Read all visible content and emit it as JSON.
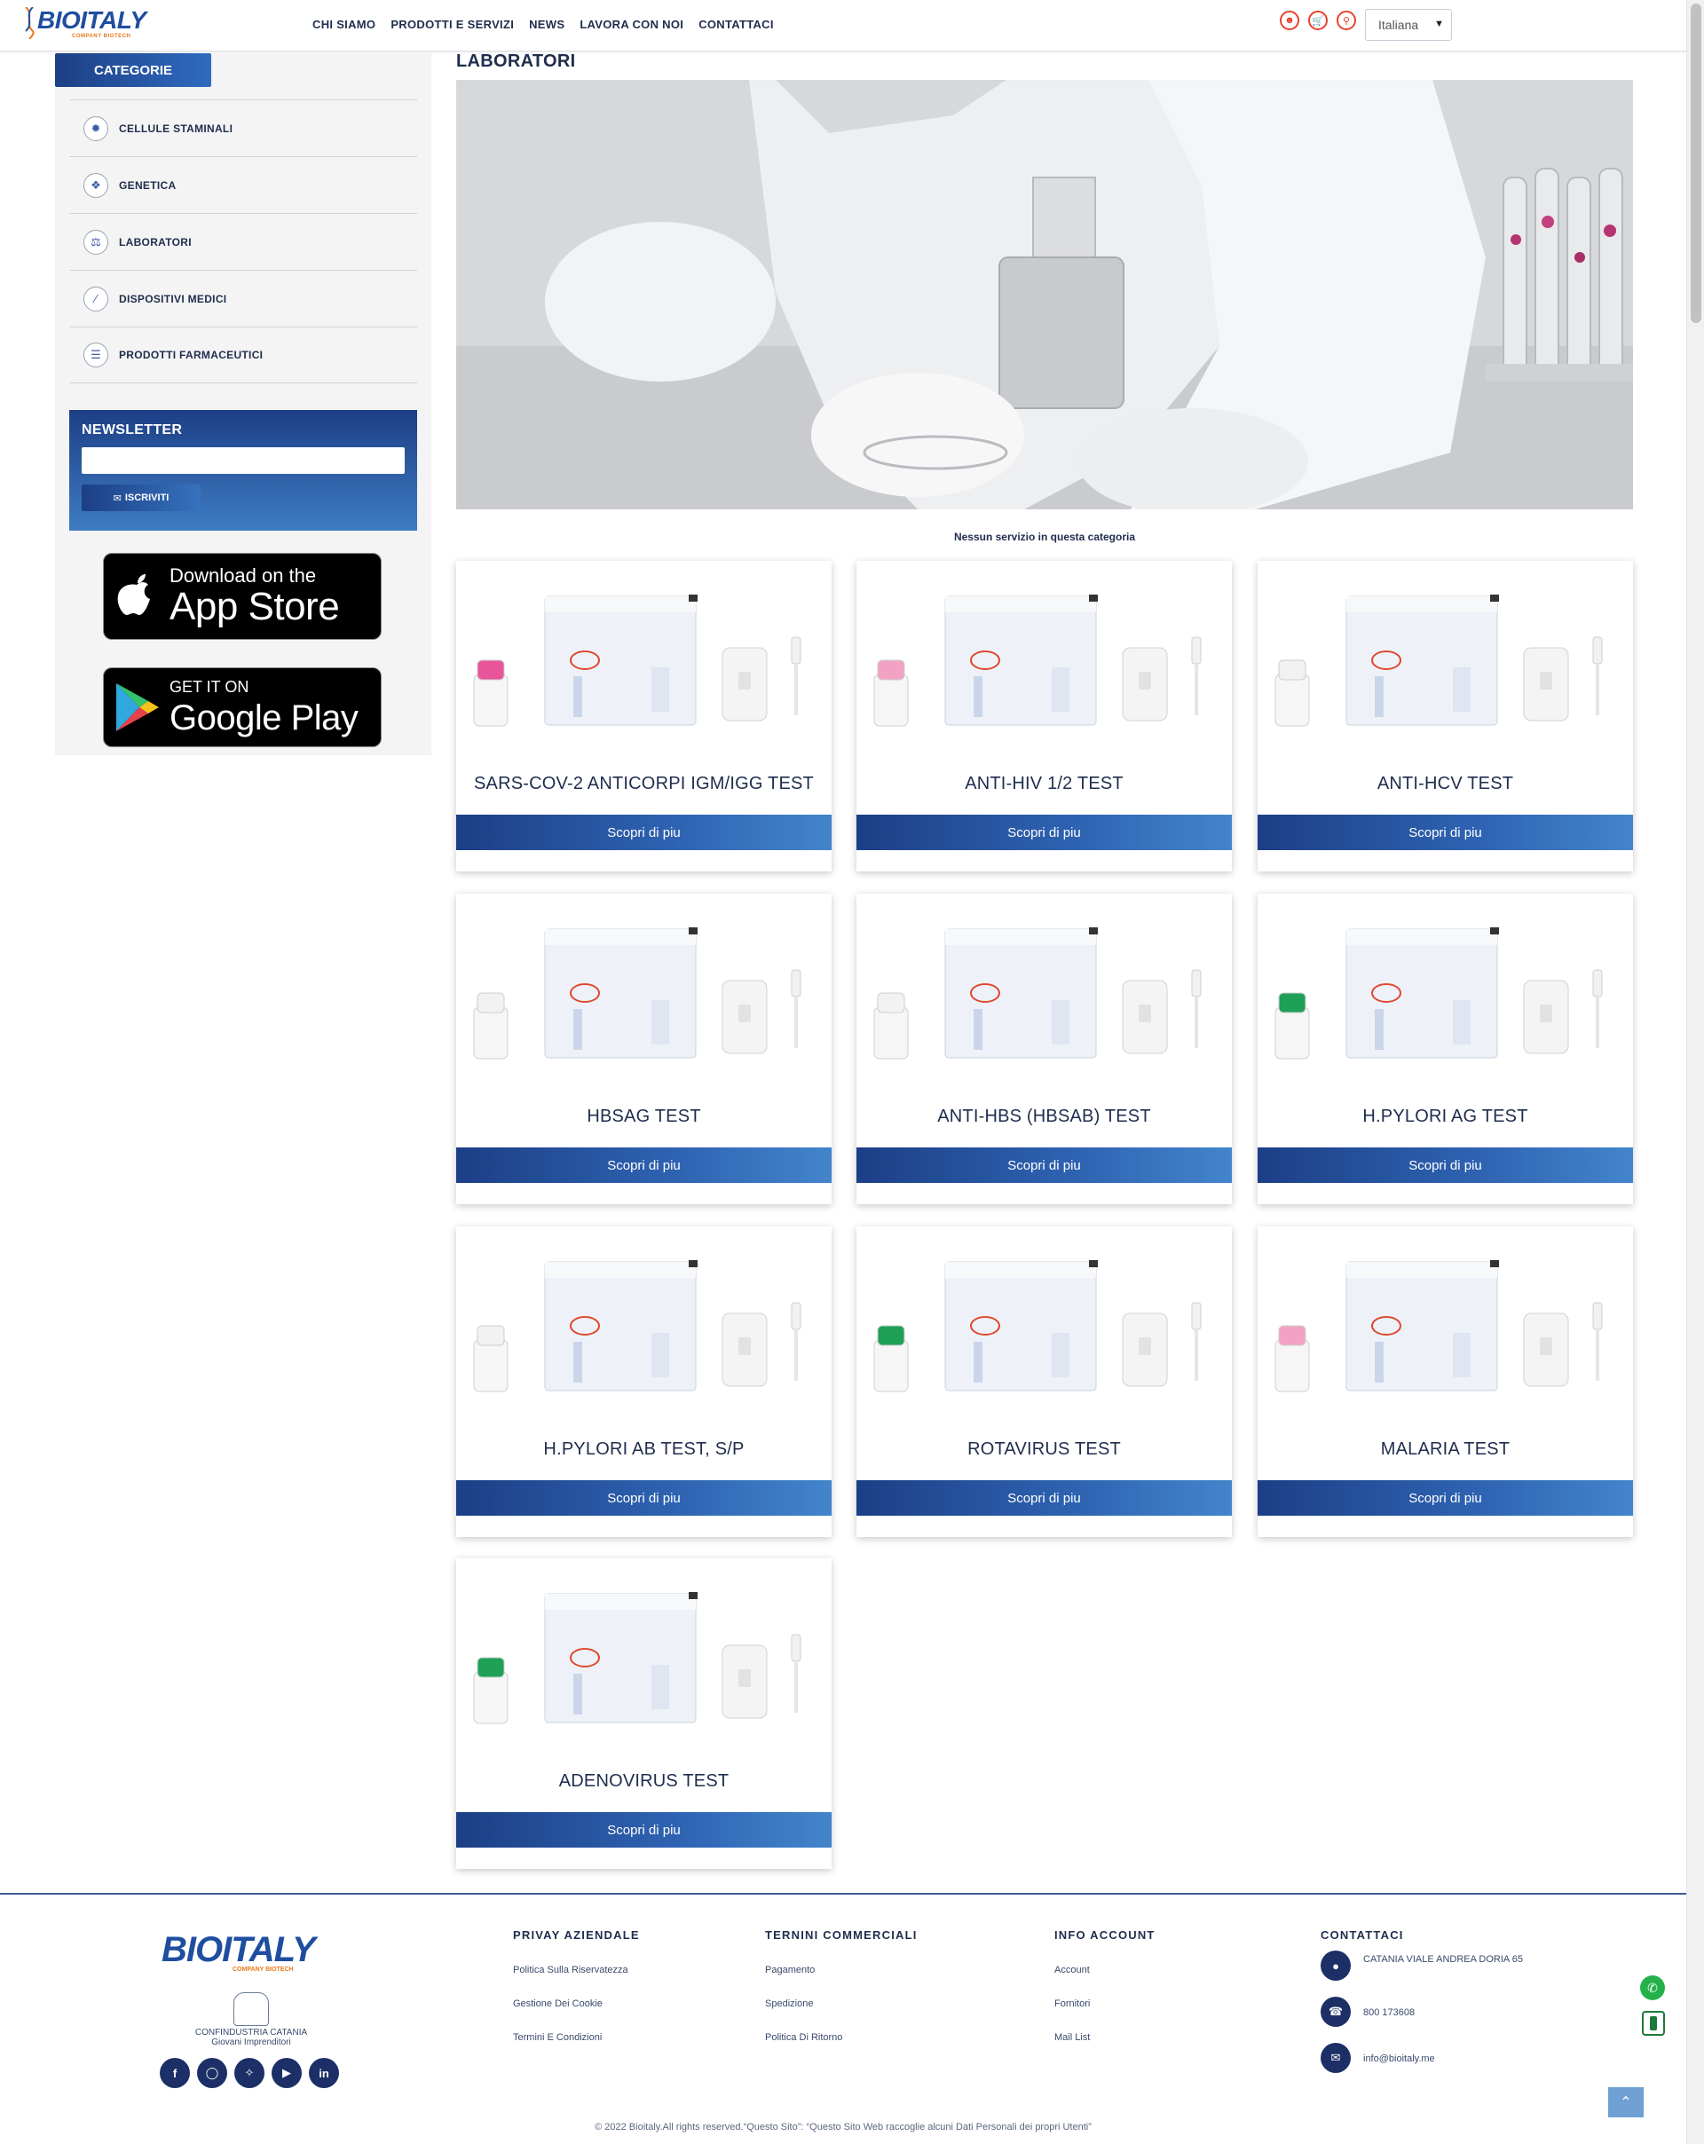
{
  "header": {
    "brand": "BIOITALY",
    "brand_tag": "COMPANY BIOTECH",
    "nav": [
      "CHI SIAMO",
      "PRODOTTI E SERVIZI",
      "NEWS",
      "LAVORA CON NOI",
      "CONTATTACI"
    ],
    "icons": [
      "user-icon",
      "cart-icon",
      "search-icon"
    ],
    "language": "Italiana"
  },
  "sidebar": {
    "categories_button": "CATEGORIE",
    "items": [
      {
        "label": "CELLULE STAMINALI",
        "icon": "cell-icon"
      },
      {
        "label": "GENETICA",
        "icon": "dna-icon"
      },
      {
        "label": "LABORATORI",
        "icon": "lab-icon"
      },
      {
        "label": "DISPOSITIVI MEDICI",
        "icon": "syringe-icon"
      },
      {
        "label": "PRODOTTI FARMACEUTICI",
        "icon": "pharma-icon"
      }
    ],
    "newsletter": {
      "title": "NEWSLETTER",
      "button": "ISCRIVITI"
    },
    "stores": {
      "apple_small": "Download on the",
      "apple_big": "App Store",
      "google_small": "GET IT ON",
      "google_big": "Google Play"
    }
  },
  "main": {
    "title": "LABORATORI",
    "empty_message": "Nessun servizio in questa categoria",
    "button_label": "Scopri di piu",
    "products": [
      {
        "name": "SARS-COV-2 ANTICORPI IGM/IGG TEST",
        "cap": "#e8559a"
      },
      {
        "name": "ANTI-HIV 1/2 TEST",
        "cap": "#f2a3c4"
      },
      {
        "name": "ANTI-HCV TEST",
        "cap": "#f2f2f2"
      },
      {
        "name": "HBSAG TEST",
        "cap": "#f2f2f2"
      },
      {
        "name": "ANTI-HBS (HBSAB) TEST",
        "cap": "#f2f2f2"
      },
      {
        "name": "H.PYLORI AG TEST",
        "cap": "#1fa057"
      },
      {
        "name": "H.PYLORI AB TEST, S/P",
        "cap": "#f2f2f2"
      },
      {
        "name": "ROTAVIRUS TEST",
        "cap": "#1fa057"
      },
      {
        "name": "MALARIA TEST",
        "cap": "#f2a3c4"
      },
      {
        "name": "ADENOVIRUS TEST",
        "cap": "#1fa057"
      }
    ]
  },
  "footer": {
    "brand": "BIOITALY",
    "brand_tag": "COMPANY BIOTECH",
    "confind_line1": "CONFINDUSTRIA CATANIA",
    "confind_line2": "Giovani Imprenditori",
    "socials": [
      "f",
      "ig",
      "tw",
      "yt",
      "in"
    ],
    "col1": {
      "title": "PRIVAY AZIENDALE",
      "links": [
        "Politica Sulla Riservatezza",
        "Gestione Dei Cookie",
        "Termini E Condizioni"
      ]
    },
    "col2": {
      "title": "TERNINI COMMERCIALI",
      "links": [
        "Pagamento",
        "Spedizione",
        "Politica Di Ritorno"
      ]
    },
    "col3": {
      "title": "INFO ACCOUNT",
      "links": [
        "Account",
        "Fornitori",
        "Mail List"
      ]
    },
    "contact": {
      "title": "CONTATTACI",
      "address": "CATANIA VIALE ANDREA DORIA 65",
      "phone": "800 173608",
      "email": "info@bioitaly.me"
    },
    "copyright": "© 2022 Bioitaly.All rights reserved.“Questo Sito”: “Questo Sito Web raccoglie alcuni Dati Personali dei propri Utenti”"
  },
  "colors": {
    "primary": "#1c3f86",
    "accent": "#e8432c",
    "text": "#1f2d4d"
  }
}
